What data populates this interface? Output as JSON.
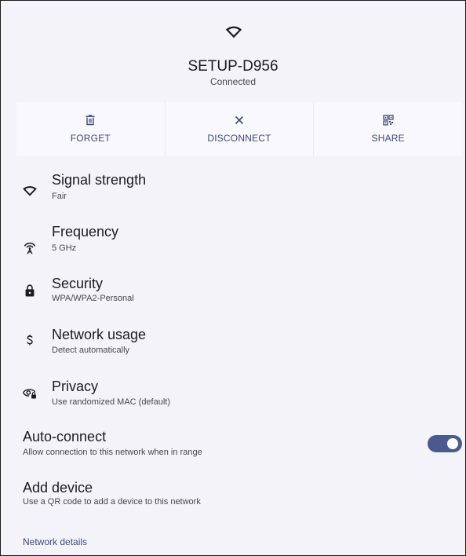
{
  "network": {
    "name": "SETUP-D956",
    "status": "Connected"
  },
  "actions": [
    {
      "label": "FORGET",
      "icon": "trash-icon"
    },
    {
      "label": "DISCONNECT",
      "icon": "close-icon"
    },
    {
      "label": "SHARE",
      "icon": "qr-code-icon"
    }
  ],
  "details": [
    {
      "title": "Signal strength",
      "subtitle": "Fair",
      "icon": "wifi-icon"
    },
    {
      "title": "Frequency",
      "subtitle": "5 GHz",
      "icon": "antenna-icon"
    },
    {
      "title": "Security",
      "subtitle": "WPA/WPA2-Personal",
      "icon": "lock-icon"
    },
    {
      "title": "Network usage",
      "subtitle": "Detect automatically",
      "icon": "dollar-icon"
    },
    {
      "title": "Privacy",
      "subtitle": "Use randomized MAC (default)",
      "icon": "privacy-eye-icon"
    }
  ],
  "auto_connect": {
    "title": "Auto-connect",
    "subtitle": "Allow connection to this network when in range",
    "enabled": true
  },
  "add_device": {
    "title": "Add device",
    "subtitle": "Use a QR code to add a device to this network"
  },
  "network_details_link": "Network details",
  "colors": {
    "accent": "#4a5a8f",
    "background": "#f4f3f9",
    "action_text": "#3b4a7a"
  }
}
